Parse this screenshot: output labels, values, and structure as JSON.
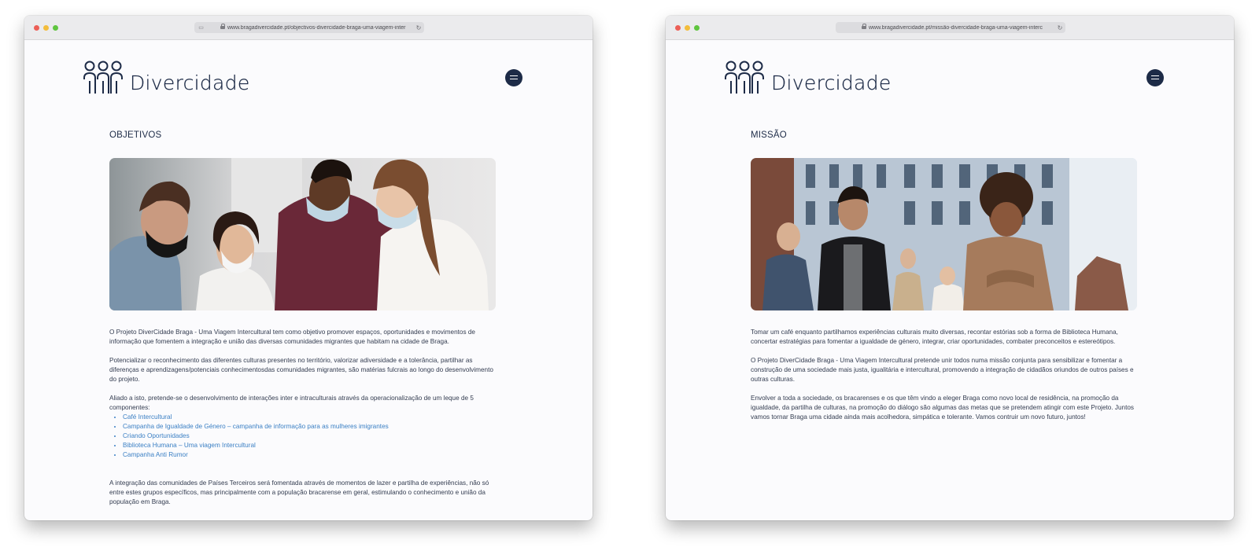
{
  "left_window": {
    "url": "www.bragadivercidade.pt/objectivos-divercidade-braga-uma-viagem-inter",
    "logo_text": "Divercidade",
    "section_title": "OBJETIVOS",
    "paragraphs": [
      "O Projeto DiverCidade Braga - Uma Viagem Intercultural tem como objetivo promover espaços, oportunidades e movimentos de informação que fomentem a integração e união das diversas comunidades migrantes que habitam na cidade de Braga.",
      "Potencializar o reconhecimento das diferentes culturas presentes no território, valorizar adiversidade e a tolerância, partilhar as diferenças e aprendizagens/potenciais conhecimentosdas comunidades migrantes, são matérias fulcrais ao longo do desenvolvimento do projeto.",
      "Aliado a isto, pretende-se o desenvolvimento de interações inter e intraculturais através da operacionalização de um leque de 5 componentes:"
    ],
    "list_items": [
      "Café Intercultural",
      "Campanha de Igualdade de Género – campanha de informação para as mulheres imigrantes",
      "Criando Oportunidades",
      "Biblioteca Humana – Uma viagem Intercultural",
      "Campanha Anti Rumor"
    ],
    "closing_paragraph": "A integração das comunidades de Países Terceiros será fomentada através de momentos de lazer e partilha de experiências, não só entre estes grupos específicos, mas principalmente com a população bracarense em geral, estimulando o conhecimento e união da população em Braga."
  },
  "right_window": {
    "url": "www.bragadivercidade.pt/missão-divercidade-braga-uma-viagem-interc",
    "logo_text": "Divercidade",
    "section_title": "MISSÃO",
    "paragraphs": [
      "Tomar um café enquanto partilhamos experiências culturais muito diversas, recontar estórias sob a forma de Biblioteca Humana, concertar estratégias para fomentar a igualdade de género, integrar, criar oportunidades, combater preconceitos e estereótipos.",
      "O Projeto DiverCidade Braga - Uma Viagem Intercultural pretende unir todos numa missão conjunta para sensibilizar e fomentar a construção de uma sociedade mais justa, igualitária e intercultural, promovendo a integração de cidadãos oriundos de outros países e outras culturas.",
      "Envolver a toda a sociedade, os bracarenses e os que têm vindo a eleger Braga como novo local de residência, na promoção da igualdade, da partilha de culturas, na promoção do diálogo são algumas das metas que se pretendem atingir com este Projeto. Juntos vamos tornar Braga uma cidade ainda mais acolhedora, simpática e tolerante. Vamos contruir um novo futuro, juntos!"
    ]
  },
  "colors": {
    "brand_navy": "#1d2b47",
    "link_blue": "#3a7fc4",
    "text": "#333c50"
  },
  "icons": [
    "page-icon",
    "lock-icon",
    "reload-icon",
    "menu-icon",
    "people-logo-icon"
  ]
}
